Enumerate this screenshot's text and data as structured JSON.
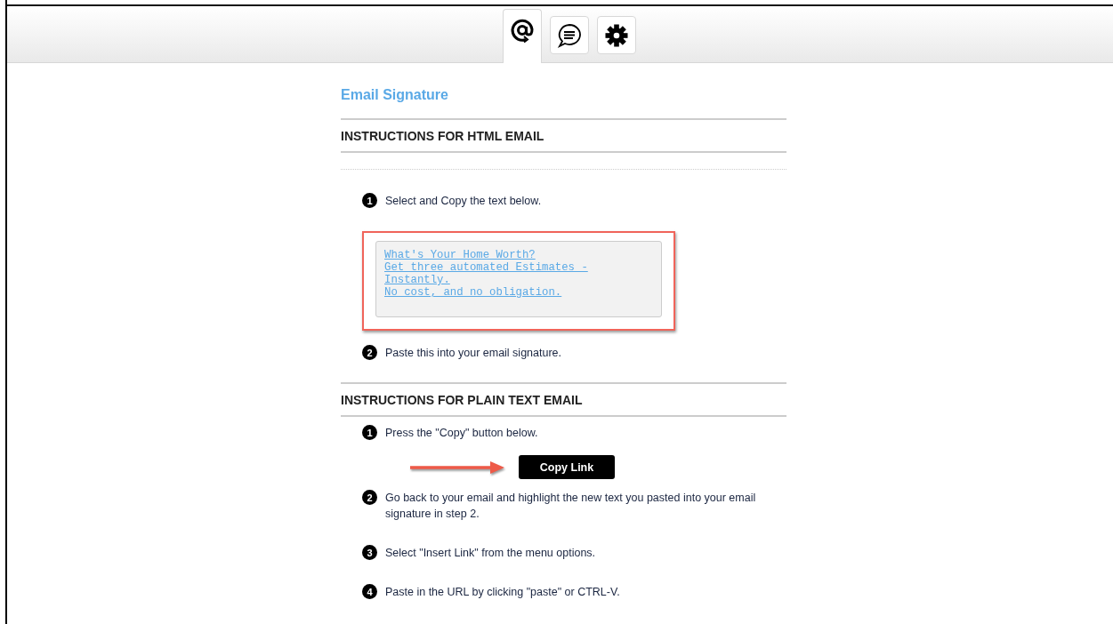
{
  "tabs": [
    {
      "kind": "at",
      "selected": true
    },
    {
      "kind": "chat",
      "selected": false
    },
    {
      "kind": "settings",
      "selected": false
    }
  ],
  "title": "Email Signature",
  "sections": [
    {
      "heading": "INSTRUCTIONS FOR HTML EMAIL",
      "dotted_rule": true,
      "items": [
        {
          "kind": "step",
          "number": "1",
          "text": "Select and Copy the text below."
        },
        {
          "kind": "code",
          "highlighted": true,
          "links": [
            "What's Your Home Worth?",
            "Get three automated Estimates - Instantly.",
            "No cost, and no obligation."
          ]
        },
        {
          "kind": "step",
          "number": "2",
          "text": "Paste this into your email signature."
        }
      ]
    },
    {
      "heading": "INSTRUCTIONS FOR PLAIN TEXT EMAIL",
      "dotted_rule": false,
      "items": [
        {
          "kind": "step",
          "number": "1",
          "text": "Press the \"Copy\" button below."
        },
        {
          "kind": "button",
          "label": "Copy Link",
          "arrow": true
        },
        {
          "kind": "step",
          "number": "2",
          "text": "Go back to your email and highlight the new text you pasted into your email signature in step 2."
        },
        {
          "kind": "step",
          "number": "3",
          "text": "Select \"Insert Link\" from the menu options."
        },
        {
          "kind": "step",
          "number": "4",
          "text": "Paste in the URL by clicking \"paste\" or CTRL-V."
        }
      ]
    }
  ]
}
